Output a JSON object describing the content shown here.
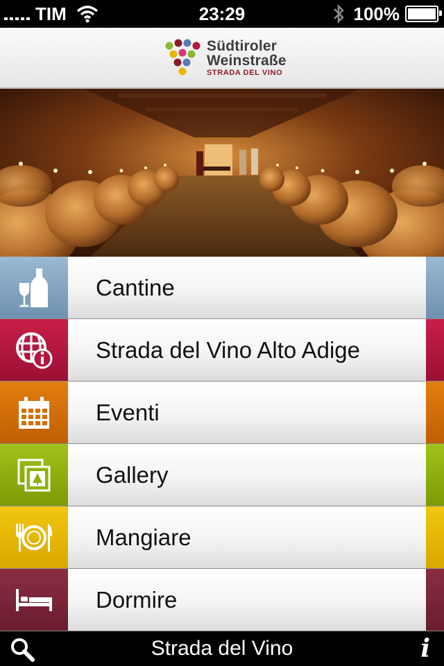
{
  "status_bar": {
    "carrier": "TIM",
    "time": "23:29",
    "battery": "100%"
  },
  "header": {
    "logo_line1": "Südtiroler",
    "logo_line2": "Weinstraße",
    "logo_line3": "STRADA DEL VINO"
  },
  "hero": {
    "icon": "wine-cellar-photo"
  },
  "menu": {
    "items": [
      {
        "label": "Cantine",
        "icon": "wine-bottle-glass-icon",
        "color": "#86a9c6"
      },
      {
        "label": "Strada del Vino Alto Adige",
        "icon": "globe-info-icon",
        "color": "#b5153d"
      },
      {
        "label": "Eventi",
        "icon": "calendar-icon",
        "color": "#d56e06"
      },
      {
        "label": "Gallery",
        "icon": "gallery-icon",
        "color": "#8fb00b"
      },
      {
        "label": "Mangiare",
        "icon": "plate-cutlery-icon",
        "color": "#e9b904"
      },
      {
        "label": "Dormire",
        "icon": "bed-icon",
        "color": "#7d2438"
      }
    ]
  },
  "bottom_bar": {
    "title": "Strada del Vino",
    "search_icon": "search-icon",
    "info_label": "i"
  }
}
